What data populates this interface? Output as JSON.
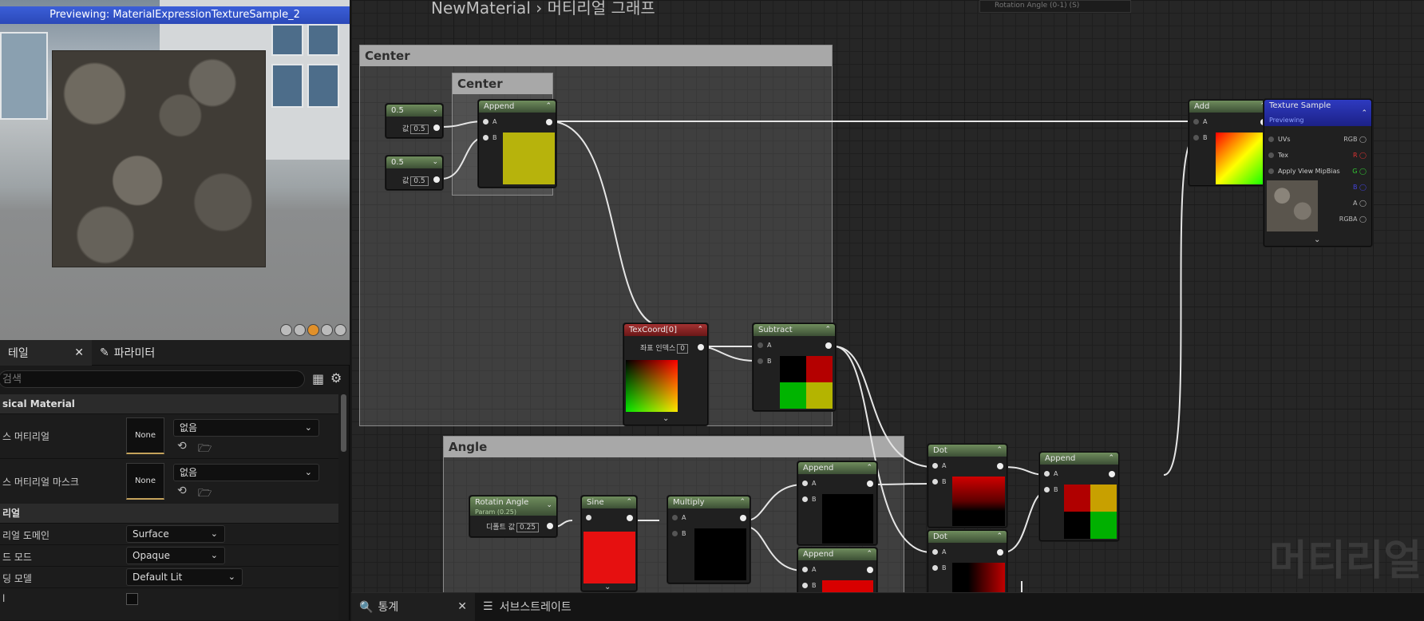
{
  "viewport": {
    "preview_label": "Previewing: MaterialExpressionTextureSample_2"
  },
  "details": {
    "tab_details": "테일",
    "tab_params": "파라미터",
    "search_placeholder": "검색",
    "cat_physical": "sical Material",
    "phys_material": "스 머티리얼",
    "phys_mask": "스 머티리얼 마스크",
    "none": "None",
    "none_value": "없음",
    "cat_material": "리얼",
    "domain_label": "리얼 도메인",
    "domain_value": "Surface",
    "blend_label": "드 모드",
    "blend_value": "Opaque",
    "shading_label": "딩 모델",
    "shading_value": "Default Lit",
    "last_label": "l"
  },
  "graph": {
    "breadcrumb": "NewMaterial  ›  머티리얼 그래프",
    "tooltip_node": "Rotation Angle (0-1) (S)",
    "comments": {
      "center_outer": "Center",
      "center_inner": "Center",
      "angle": "Angle"
    },
    "nodes": {
      "const1": {
        "title": "0.5",
        "pin": "값",
        "value": "0.5"
      },
      "const2": {
        "title": "0.5",
        "pin": "값",
        "value": "0.5"
      },
      "append1": {
        "title": "Append",
        "a": "A",
        "b": "B"
      },
      "texcoord": {
        "title": "TexCoord[0]",
        "pin": "좌표 인덱스",
        "value": "0"
      },
      "subtract": {
        "title": "Subtract",
        "a": "A",
        "b": "B"
      },
      "add": {
        "title": "Add",
        "a": "A",
        "b": "B"
      },
      "texsample": {
        "title": "Texture Sample",
        "subtitle": "Previewing",
        "uvs": "UVs",
        "tex": "Tex",
        "mip": "Apply View MipBias",
        "rgb": "RGB",
        "r": "R",
        "g": "G",
        "b": "B",
        "a": "A",
        "rgba": "RGBA"
      },
      "rotang": {
        "title": "Rotatin Angle",
        "subtitle": "Param (0.25)",
        "pin": "디폴트 값",
        "value": "0.25"
      },
      "sine": {
        "title": "Sine"
      },
      "multiply": {
        "title": "Multiply",
        "a": "A",
        "b": "B"
      },
      "append2": {
        "title": "Append",
        "a": "A",
        "b": "B"
      },
      "append3": {
        "title": "Append",
        "a": "A",
        "b": "B"
      },
      "dot1": {
        "title": "Dot",
        "a": "A",
        "b": "B"
      },
      "dot2": {
        "title": "Dot",
        "a": "A",
        "b": "B"
      },
      "append4": {
        "title": "Append",
        "a": "A",
        "b": "B"
      }
    },
    "watermark": "머티리얼"
  },
  "bottom": {
    "tab_stats": "통계",
    "tab_substrate": "서브스트레이트"
  }
}
